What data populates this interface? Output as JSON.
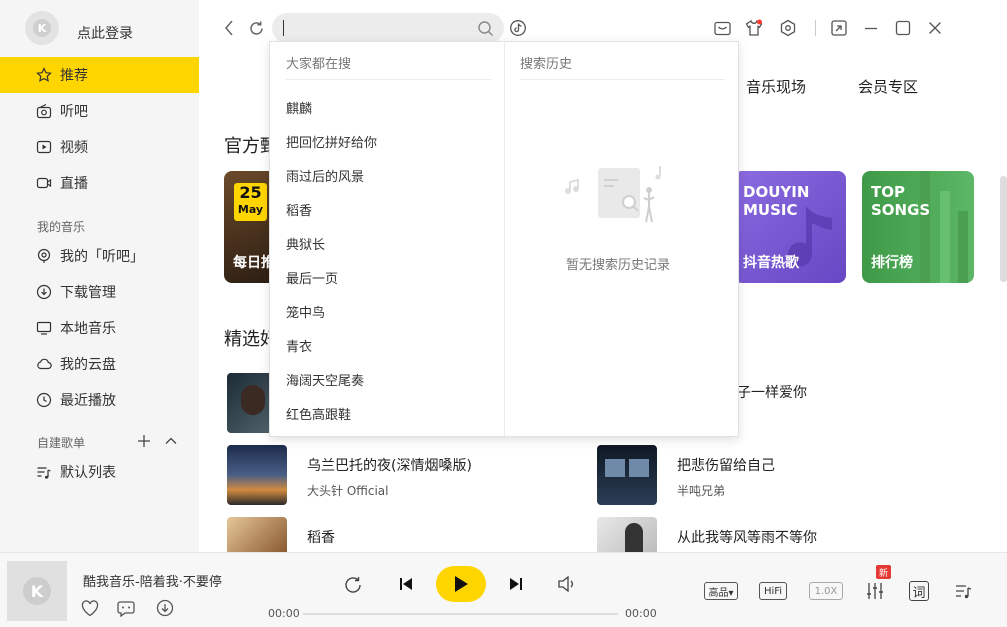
{
  "sidebar": {
    "login": "点此登录",
    "nav": [
      {
        "label": "推荐",
        "icon": "star-icon"
      },
      {
        "label": "听吧",
        "icon": "radio-icon"
      },
      {
        "label": "视频",
        "icon": "video-icon"
      },
      {
        "label": "直播",
        "icon": "live-icon"
      }
    ],
    "my_music_title": "我的音乐",
    "my_music": [
      {
        "label": "我的「听吧」",
        "icon": "mic-icon"
      },
      {
        "label": "下载管理",
        "icon": "download-icon"
      },
      {
        "label": "本地音乐",
        "icon": "monitor-icon"
      },
      {
        "label": "我的云盘",
        "icon": "cloud-icon"
      },
      {
        "label": "最近播放",
        "icon": "clock-icon"
      }
    ],
    "playlist_title": "自建歌单",
    "playlists": [
      {
        "label": "默认列表",
        "icon": "playlist-icon"
      }
    ]
  },
  "main": {
    "tabs": [
      "音乐现场",
      "会员专区"
    ],
    "section_official": "官方甄",
    "section_featured": "精选好",
    "cards": [
      {
        "top": "",
        "bottom": "每日推",
        "date_day": "25",
        "date_month": "May"
      },
      {
        "top": "DOUYIN\nMUSIC",
        "bottom": "抖音热歌"
      },
      {
        "top": "TOP\nSONGS",
        "bottom": "排行榜"
      }
    ],
    "songs": [
      {
        "title": "",
        "artist": ""
      },
      {
        "title": "子一样爱你",
        "artist": ""
      },
      {
        "title": "乌兰巴托的夜(深情烟嗓版)",
        "artist": "大头针 Official"
      },
      {
        "title": "把悲伤留给自己",
        "artist": "半吨兄弟"
      },
      {
        "title": "稻香",
        "artist": ""
      },
      {
        "title": "从此我等风等雨不等你",
        "artist": ""
      }
    ]
  },
  "search": {
    "value": "",
    "hot_title": "大家都在搜",
    "history_title": "搜索历史",
    "hot": [
      "麒麟",
      "把回忆拼好给你",
      "雨过后的风景",
      "稻香",
      "典狱长",
      "最后一页",
      "笼中鸟",
      "青衣",
      "海阔天空尾奏",
      "红色高跟鞋"
    ],
    "empty": "暂无搜索历史记录"
  },
  "player": {
    "track": "酷我音乐-陪着我·不要停",
    "time_current": "00:00",
    "time_total": "00:00",
    "progress": 0,
    "quality": "高品▾",
    "hifi": "HiFi",
    "speed": "1.0X",
    "new_badge": "新",
    "lyrics": "词"
  },
  "colors": {
    "accent": "#ffd500",
    "douyin": "#7c5bd2",
    "top": "#4caa55"
  }
}
